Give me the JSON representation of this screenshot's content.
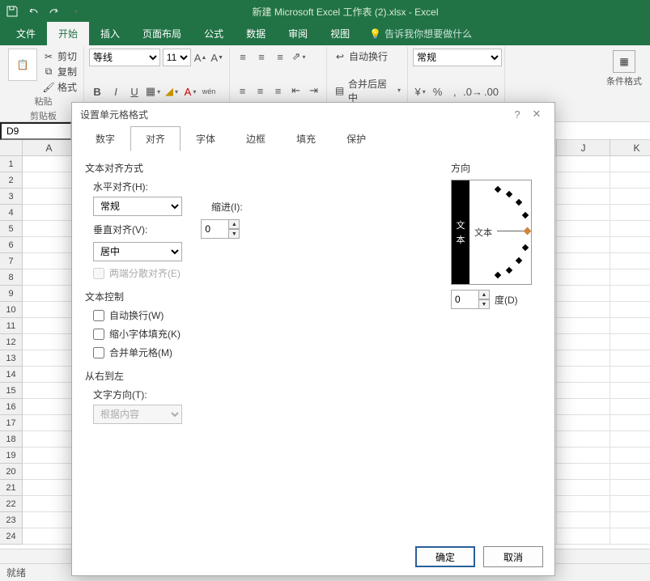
{
  "titlebar": {
    "title": "新建 Microsoft Excel 工作表 (2).xlsx - Excel"
  },
  "ribbon": {
    "tabs": {
      "file": "文件",
      "home": "开始",
      "insert": "插入",
      "layout": "页面布局",
      "formula": "公式",
      "data": "数据",
      "review": "审阅",
      "view": "视图"
    },
    "tellme": "告诉我你想要做什么",
    "clipboard": {
      "cut": "剪切",
      "copy": "复制",
      "format_painter": "格式",
      "paste": "粘贴",
      "title": "剪贴板"
    },
    "font": {
      "name": "等线",
      "size": "11"
    },
    "alignment": {
      "wrap": "自动换行",
      "merge": "合并后居中"
    },
    "number": {
      "style": "常规"
    },
    "cond_format": "条件格式"
  },
  "namebox": "D9",
  "columns": [
    "A",
    "",
    "",
    "",
    "",
    "",
    "",
    "",
    "",
    "",
    "J",
    "K"
  ],
  "rows": [
    "1",
    "2",
    "3",
    "4",
    "5",
    "6",
    "7",
    "8",
    "9",
    "10",
    "11",
    "12",
    "13",
    "14",
    "15",
    "16",
    "17",
    "18",
    "19",
    "20",
    "21",
    "22",
    "23",
    "24"
  ],
  "statusbar": "就绪",
  "dialog": {
    "title": "设置单元格格式",
    "help": "?",
    "tabs": {
      "number": "数字",
      "align": "对齐",
      "font": "字体",
      "border": "边框",
      "fill": "填充",
      "protect": "保护"
    },
    "align": {
      "sect_title": "文本对齐方式",
      "h_label": "水平对齐(H):",
      "h_value": "常规",
      "indent_label": "缩进(I):",
      "indent_value": "0",
      "v_label": "垂直对齐(V):",
      "v_value": "居中",
      "distributed": "两端分散对齐(E)"
    },
    "control": {
      "sect_title": "文本控制",
      "wrap": "自动换行(W)",
      "shrink": "缩小字体填充(K)",
      "merge": "合并单元格(M)"
    },
    "rtl": {
      "sect_title": "从右到左",
      "dir_label": "文字方向(T):",
      "dir_value": "根据内容"
    },
    "orient": {
      "sect_title": "方向",
      "v1": "文",
      "v2": "本",
      "label": "文本",
      "deg_value": "0",
      "deg_label": "度(D)"
    },
    "ok": "确定",
    "cancel": "取消"
  }
}
